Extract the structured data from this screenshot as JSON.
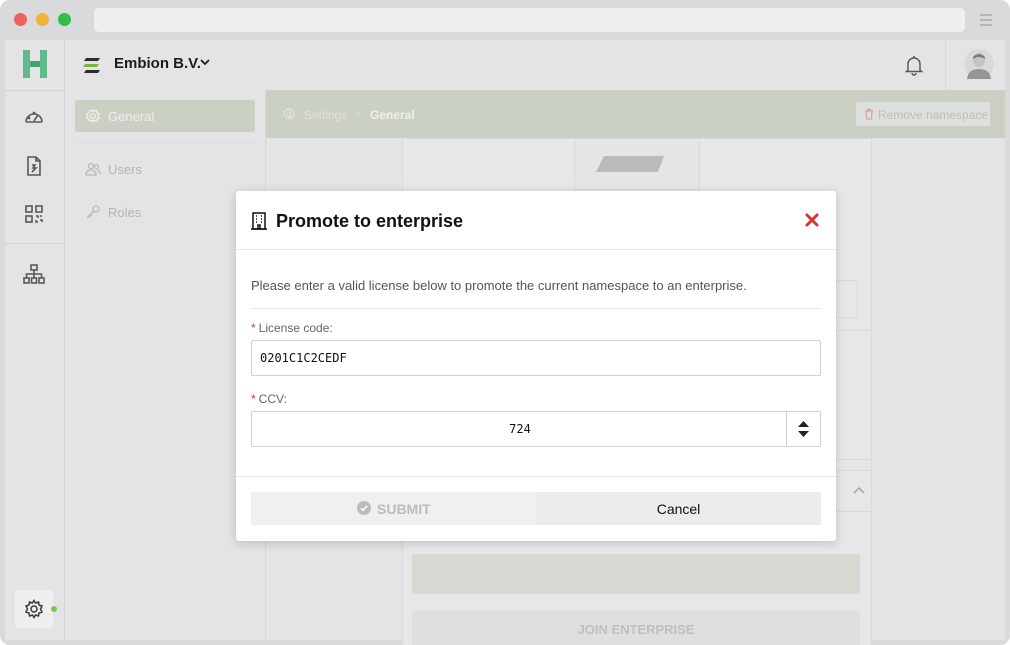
{
  "topbar": {
    "org_name": "Embion B.V."
  },
  "subnav": {
    "items": [
      {
        "label": "General"
      },
      {
        "label": "Users"
      },
      {
        "label": "Roles"
      }
    ]
  },
  "breadcrumb": {
    "settings": "Settings",
    "separator": ">",
    "current": "General"
  },
  "toolbar": {
    "remove_label": "Remove namespace"
  },
  "background": {
    "join_label": "JOIN ENTERPRISE"
  },
  "modal": {
    "title": "Promote to enterprise",
    "description": "Please enter a valid license below to promote the current namespace to an enterprise.",
    "license_label": "License code:",
    "license_value": "0201C1C2CEDF",
    "ccv_label": "CCV:",
    "ccv_value": "724",
    "required_mark": "*",
    "submit_label": "SUBMIT",
    "cancel_label": "Cancel"
  },
  "colors": {
    "accent_green": "#d6dccf",
    "logo_green": "#5cc48a",
    "close_red": "#e03131",
    "status_green": "#7bd34a"
  },
  "icons": [
    "gauge-icon",
    "document-icon",
    "qr-icon",
    "hierarchy-icon",
    "gear-icon",
    "bell-icon",
    "building-icon",
    "close-icon",
    "check-circle-icon",
    "users-icon",
    "key-icon",
    "trash-icon"
  ]
}
